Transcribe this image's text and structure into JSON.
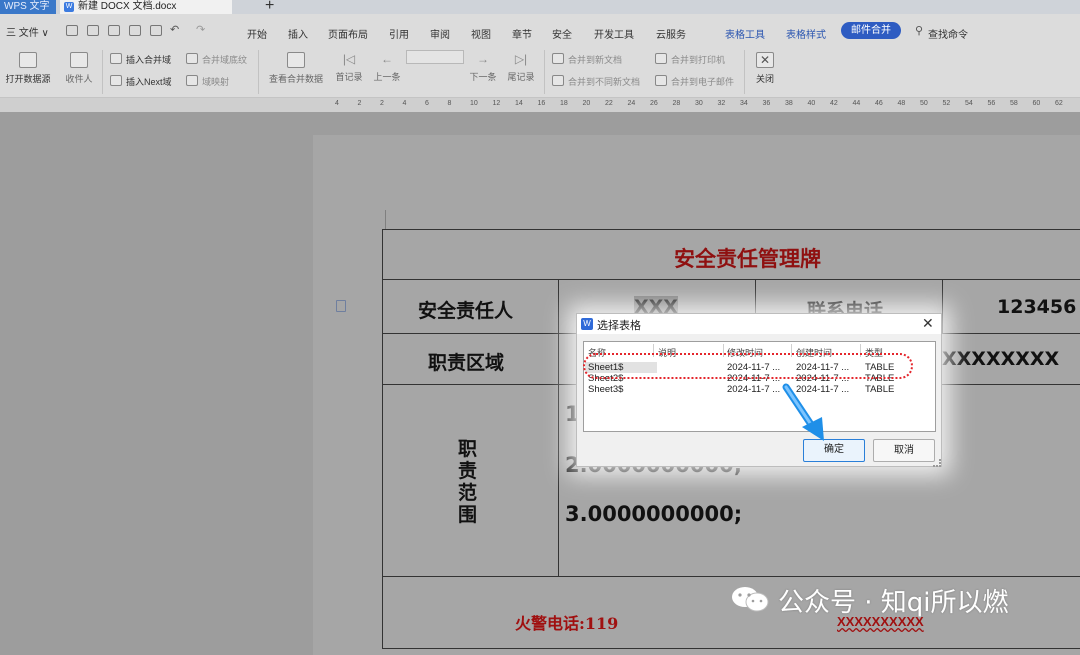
{
  "titlebar": {
    "app_tab": "WPS 文字",
    "doc_tab": "新建 DOCX 文档.docx",
    "add_tab": "+"
  },
  "menubar": {
    "file": "三 文件 ∨",
    "items": [
      "开始",
      "插入",
      "页面布局",
      "引用",
      "审阅",
      "视图",
      "章节",
      "安全",
      "开发工具",
      "云服务"
    ],
    "context_tabs": [
      "表格工具",
      "表格样式"
    ],
    "active_tab": "邮件合并",
    "search": "查找命令"
  },
  "ribbon": {
    "open_data_source": "打开数据源",
    "recipients": "收件人",
    "insert_merge_field": "插入合并域",
    "insert_next_field": "插入Next域",
    "merge_field_shading": "合并域底纹",
    "field_map": "域映射",
    "view_merged_data": "查看合并数据",
    "first_record": "首记录",
    "prev_record": "上一条",
    "next_record": "下一条",
    "last_record": "尾记录",
    "merge_to_new_doc": "合并到新文档",
    "merge_to_diff_doc": "合并到不同新文档",
    "merge_to_printer": "合并到打印机",
    "merge_to_email": "合并到电子邮件",
    "close": "关闭"
  },
  "ruler": [
    "4",
    "2",
    "2",
    "4",
    "6",
    "8",
    "10",
    "12",
    "14",
    "16",
    "18",
    "20",
    "22",
    "24",
    "26",
    "28",
    "30",
    "32",
    "34",
    "36",
    "38",
    "40",
    "42",
    "44",
    "46",
    "48",
    "50",
    "52",
    "54",
    "56",
    "58",
    "60",
    "62"
  ],
  "document_table": {
    "title": "安全责任管理牌",
    "responsible_label": "安全责任人",
    "responsible_value": "XXX",
    "phone_label": "联系电话",
    "phone_value": "123456",
    "area_label": "职责区域",
    "area_value": "XXXXXXXX",
    "scope_label_chars": [
      "职",
      "责",
      "范",
      "围"
    ],
    "scope_lines": [
      "1",
      "2.0000000000;",
      "3.0000000000;"
    ],
    "fire_phone": "火警电话:119",
    "footer_red": "XXXXXXXXXX"
  },
  "dialog": {
    "title": "选择表格",
    "close": "✕",
    "columns": [
      "名称",
      "说明",
      "修改时间",
      "创建时间",
      "类型"
    ],
    "rows": [
      {
        "name": "Sheet1$",
        "desc": "",
        "modified": "2024-11-7 ...",
        "created": "2024-11-7 ...",
        "type": "TABLE"
      },
      {
        "name": "Sheet2$",
        "desc": "",
        "modified": "2024-11-7 ...",
        "created": "2024-11-7 ...",
        "type": "TABLE"
      },
      {
        "name": "Sheet3$",
        "desc": "",
        "modified": "2024-11-7 ...",
        "created": "2024-11-7 ...",
        "type": "TABLE"
      }
    ],
    "ok": "确定",
    "cancel": "取消"
  },
  "watermark": {
    "text": "公众号 · 知qi所以燃"
  },
  "colors": {
    "accent": "#2e5cc2",
    "title_red": "#8f1010",
    "annotation_red": "#e4262c",
    "arrow_blue": "#1f8fe8"
  }
}
